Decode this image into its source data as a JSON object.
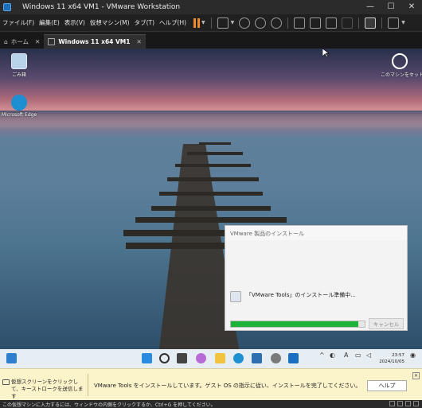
{
  "window": {
    "title": "Windows 11 x64 VM1 - VMware Workstation"
  },
  "menu": {
    "items": [
      "ファイル(F)",
      "編集(E)",
      "表示(V)",
      "仮想マシン(M)",
      "タブ(T)",
      "ヘルプ(H)"
    ]
  },
  "tabs": [
    {
      "label": "ホーム",
      "icon": "home-icon"
    },
    {
      "label": "Windows 11 x64 VM1",
      "icon": "vm-icon"
    }
  ],
  "desktop": {
    "icons": [
      {
        "label": "ごみ箱",
        "icon": "recycle-bin-icon"
      },
      {
        "label": "Microsoft Edge",
        "icon": "edge-icon"
      }
    ],
    "user_icon_label": "このマシンをセットアップ"
  },
  "installer": {
    "title": "VMware 製品のインストール",
    "message": "「VMware Tools」のインストール準備中...",
    "cancel_label": "キャンセル",
    "progress": 0.95
  },
  "taskbar": {
    "time": "23:57",
    "date": "2024/10/05",
    "ime_label": "A",
    "icons": [
      "widgets-icon",
      "start-icon",
      "search-icon",
      "task-view-icon",
      "copilot-icon",
      "file-explorer-icon",
      "edge-icon",
      "store-icon",
      "settings-icon",
      "outlook-icon"
    ]
  },
  "hint": {
    "left_text": "仮想スクリーンをクリックして、キーストロークを送信します",
    "message": "VMware Tools をインストールしています。ゲスト OS の指示に従い、インストールを完了してください。",
    "help_label": "ヘルプ"
  },
  "status": {
    "text": "この仮想マシンに入力するには、ウィンドウの内側をクリックするか、Ctrl+G を押してください。"
  },
  "colors": {
    "pause": "#f08a2c",
    "progress": "#1db33a",
    "hint_bg": "#fbf3c9",
    "taskbar_bg": "#e6edf3"
  }
}
